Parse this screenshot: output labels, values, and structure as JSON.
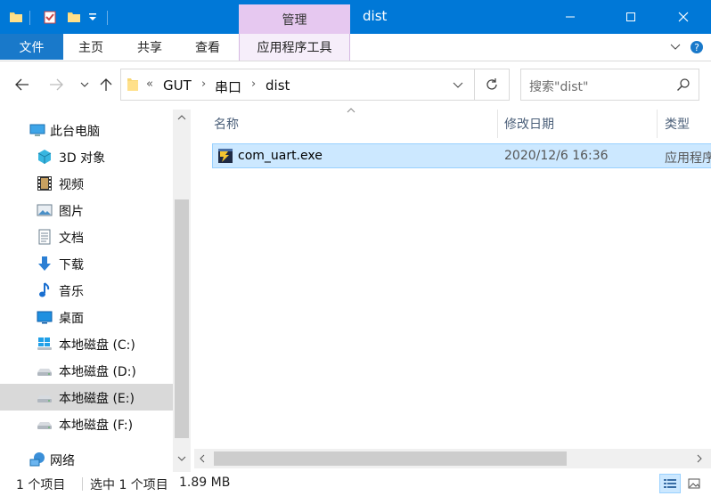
{
  "window": {
    "title": "dist",
    "context_tab": "管理"
  },
  "ribbon": {
    "tabs": [
      "文件",
      "主页",
      "共享",
      "查看",
      "应用程序工具"
    ]
  },
  "address": {
    "crumbs": [
      "GUT",
      "串口",
      "dist"
    ],
    "overflow": "«"
  },
  "search": {
    "placeholder": "搜索\"dist\""
  },
  "nav": {
    "items": [
      {
        "label": "此台电脑",
        "icon": "computer-icon"
      },
      {
        "label": "3D 对象",
        "icon": "3d-objects-icon"
      },
      {
        "label": "视频",
        "icon": "video-icon"
      },
      {
        "label": "图片",
        "icon": "pictures-icon"
      },
      {
        "label": "文档",
        "icon": "documents-icon"
      },
      {
        "label": "下载",
        "icon": "download-icon"
      },
      {
        "label": "音乐",
        "icon": "music-icon"
      },
      {
        "label": "桌面",
        "icon": "desktop-icon"
      },
      {
        "label": "本地磁盘 (C:)",
        "icon": "windows-drive-icon"
      },
      {
        "label": "本地磁盘 (D:)",
        "icon": "drive-icon"
      },
      {
        "label": "本地磁盘 (E:)",
        "icon": "drive-icon"
      },
      {
        "label": "本地磁盘 (F:)",
        "icon": "drive-icon"
      },
      {
        "label": "网络",
        "icon": "network-icon"
      }
    ],
    "selected_index": 10
  },
  "columns": [
    "名称",
    "修改日期",
    "类型"
  ],
  "files": [
    {
      "name": "com_uart.exe",
      "modified": "2020/12/6 16:36",
      "type": "应用程序",
      "icon": "exe-icon",
      "selected": true
    }
  ],
  "status": {
    "count": "1 个项目",
    "selection": "选中 1 个项目",
    "size": "1.89 MB"
  },
  "colors": {
    "titlebar": "#0078d7",
    "context_tab": "#e6c8f0",
    "selection": "#cce8ff",
    "selection_border": "#99d1ff"
  }
}
